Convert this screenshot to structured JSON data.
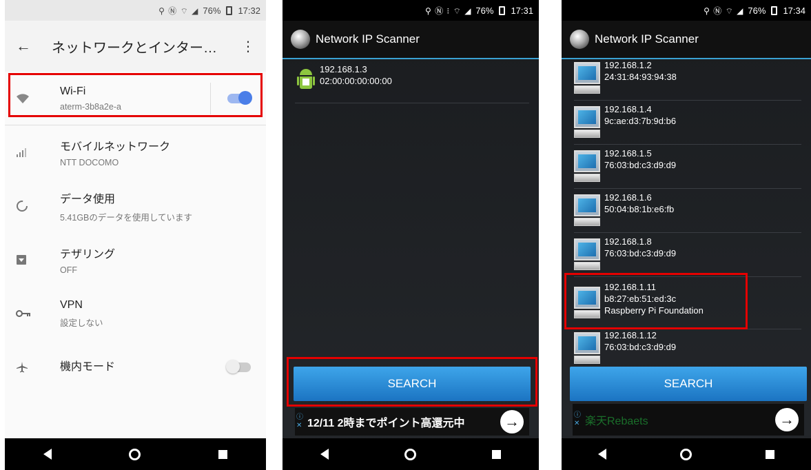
{
  "colors": {
    "highlight": "#e50000",
    "accent_blue": "#4a7ee8",
    "search_button": "#2a8ad8"
  },
  "phone1": {
    "status": {
      "battery": "76%",
      "time": "17:32"
    },
    "header": {
      "back_icon": "arrow-left-icon",
      "title": "ネットワークとインター…",
      "more_icon": "more-vert-icon"
    },
    "items": [
      {
        "icon": "wifi-icon",
        "title": "Wi-Fi",
        "sub": "aterm-3b8a2e-a",
        "toggle": "on"
      },
      {
        "icon": "signal-icon",
        "title": "モバイルネットワーク",
        "sub": "NTT DOCOMO"
      },
      {
        "icon": "data-usage-icon",
        "title": "データ使用",
        "sub": "5.41GBのデータを使用しています"
      },
      {
        "icon": "tethering-icon",
        "title": "テザリング",
        "sub": "OFF"
      },
      {
        "icon": "vpn-key-icon",
        "title": "VPN",
        "sub": "設定しない"
      },
      {
        "icon": "airplane-icon",
        "title": "機内モード",
        "toggle": "off"
      }
    ]
  },
  "phone2": {
    "status": {
      "battery": "76%",
      "time": "17:31"
    },
    "app_title": "Network IP Scanner",
    "devices": [
      {
        "ip": "192.168.1.3",
        "mac": "02:00:00:00:00:00"
      }
    ],
    "search_label": "SEARCH",
    "ad_text": "12/11 2時までポイント高還元中"
  },
  "phone3": {
    "status": {
      "battery": "76%",
      "time": "17:34"
    },
    "app_title": "Network IP Scanner",
    "devices": [
      {
        "ip": "192.168.1.2",
        "mac": "24:31:84:93:94:38"
      },
      {
        "ip": "192.168.1.4",
        "mac": "9c:ae:d3:7b:9d:b6"
      },
      {
        "ip": "192.168.1.5",
        "mac": "76:03:bd:c3:d9:d9"
      },
      {
        "ip": "192.168.1.6",
        "mac": "50:04:b8:1b:e6:fb"
      },
      {
        "ip": "192.168.1.8",
        "mac": "76:03:bd:c3:d9:d9"
      },
      {
        "ip": "192.168.1.11",
        "mac": "b8:27:eb:51:ed:3c",
        "vendor": "Raspberry Pi Foundation"
      },
      {
        "ip": "192.168.1.12",
        "mac": "76:03:bd:c3:d9:d9"
      }
    ],
    "search_label": "SEARCH",
    "ad_text": "楽天Rebaets"
  }
}
